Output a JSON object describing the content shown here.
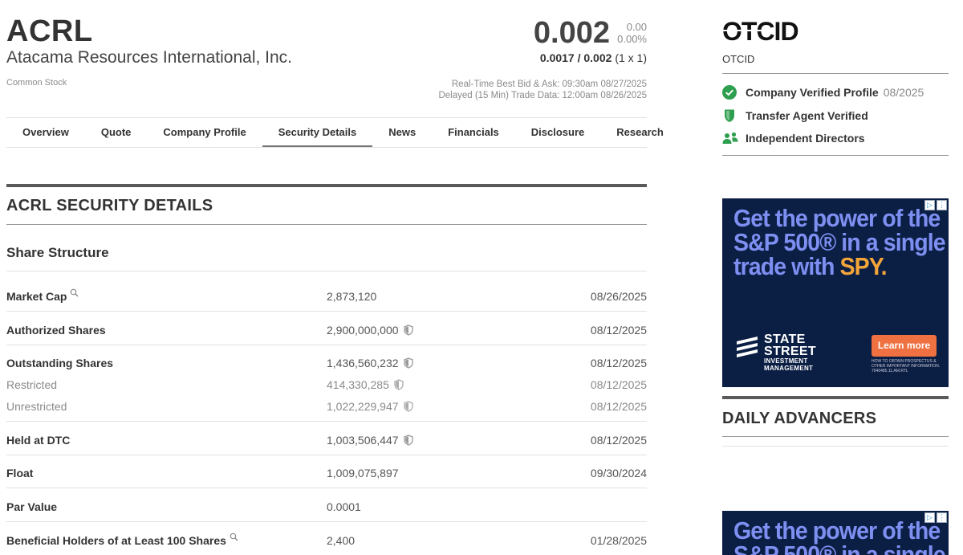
{
  "header": {
    "ticker": "ACRL",
    "company_name": "Atacama Resources International, Inc.",
    "security_type": "Common Stock",
    "price": "0.002",
    "change": "0.00",
    "change_pct": "0.00%",
    "bid_ask": "0.0017 / 0.002",
    "bid_ask_size": "(1 x 1)",
    "realtime_label": "Real-Time Best Bid & Ask: 09:30am 08/27/2025",
    "delayed_label": "Delayed (15 Min) Trade Data: 12:00am 08/26/2025"
  },
  "tabs": [
    {
      "label": "Overview"
    },
    {
      "label": "Quote"
    },
    {
      "label": "Company Profile"
    },
    {
      "label": "Security Details",
      "active": true
    },
    {
      "label": "News"
    },
    {
      "label": "Financials"
    },
    {
      "label": "Disclosure"
    },
    {
      "label": "Research"
    }
  ],
  "section": {
    "title": "ACRL SECURITY DETAILS",
    "subtitle": "Share Structure"
  },
  "rows": [
    {
      "label": "Market Cap",
      "value": "2,873,120",
      "date": "08/26/2025",
      "icon": "magnifier-icon"
    },
    {
      "label": "Authorized Shares",
      "value": "2,900,000,000",
      "date": "08/12/2025",
      "icon": "shield-icon"
    },
    {
      "label": "Outstanding Shares",
      "value": "1,436,560,232",
      "date": "08/12/2025",
      "icon": "shield-icon"
    },
    {
      "label": "Restricted",
      "value": "414,330,285",
      "date": "08/12/2025",
      "icon": "shield-icon"
    },
    {
      "label": "Unrestricted",
      "value": "1,022,229,947",
      "date": "08/12/2025",
      "icon": "shield-icon"
    },
    {
      "label": "Held at DTC",
      "value": "1,003,506,447",
      "date": "08/12/2025",
      "icon": "shield-icon"
    },
    {
      "label": "Float",
      "value": "1,009,075,897",
      "date": "09/30/2024"
    },
    {
      "label": "Par Value",
      "value": "0.0001",
      "date": ""
    },
    {
      "label": "Beneficial Holders of at Least 100 Shares",
      "value": "2,400",
      "date": "01/28/2025",
      "icon": "magnifier-icon"
    }
  ],
  "sidebar": {
    "otcid_logo_text": "OTCID",
    "otcid_label": "OTCID",
    "verifications": [
      {
        "label": "Company Verified Profile",
        "date": "08/2025",
        "icon": "check-circle-icon",
        "color": "#2e9e4f"
      },
      {
        "label": "Transfer Agent Verified",
        "date": "",
        "icon": "shield-icon",
        "color": "#2e9e4f"
      },
      {
        "label": "Independent Directors",
        "date": "",
        "icon": "people-icon",
        "color": "#2e9e4f"
      }
    ],
    "ad": {
      "line1": "Get the power of the",
      "line2": "S&P 500® in a single",
      "line3_a": "trade with ",
      "line3_b": "SPY.",
      "brand_name_1": "STATE",
      "brand_name_2": "STREET",
      "brand_sub_1": "INVESTMENT",
      "brand_sub_2": "MANAGEMENT",
      "cta": "Learn more",
      "fine_print": "HOW TO OBTAIN PROSPECTUS & OTHER IMPORTANT INFORMATION. 7040485.11.AM.RTL"
    },
    "advancers_title": "DAILY ADVANCERS"
  },
  "colors": {
    "verified_green": "#2e9e4f",
    "ad_bg": "#0b1e44",
    "ad_headline": "#7e8ff2",
    "ad_accent": "#f4a53a",
    "ad_button": "#ef7040"
  }
}
